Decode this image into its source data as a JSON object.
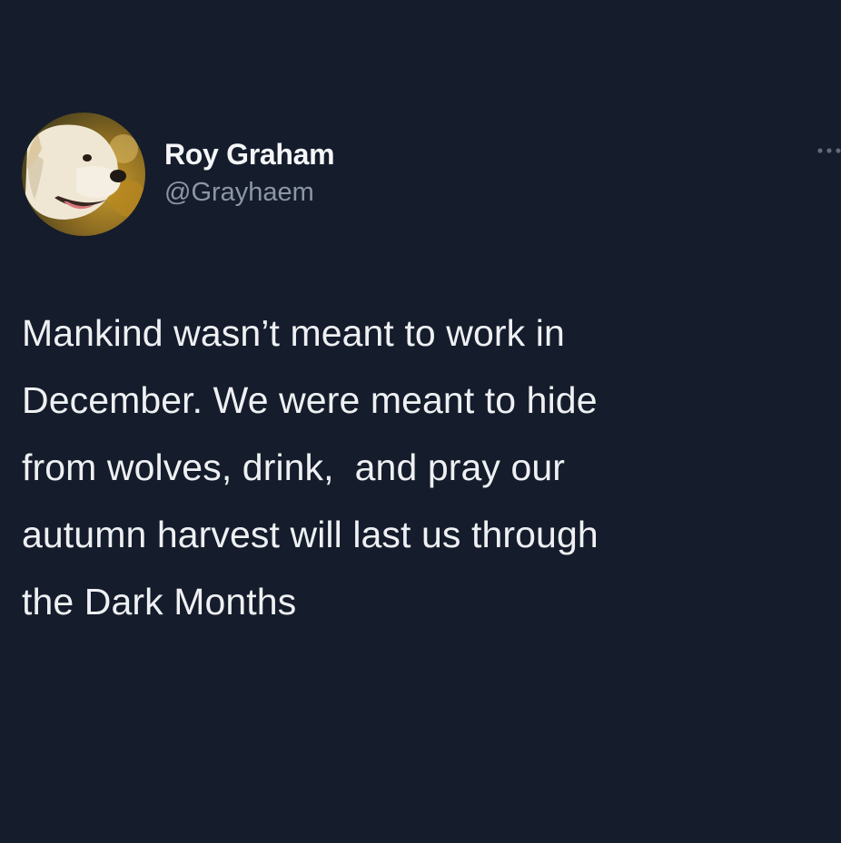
{
  "author": {
    "display_name": "Roy Graham",
    "handle": "@Grayhaem",
    "avatar_icon": "golden-retriever-avatar"
  },
  "menu": {
    "icon": "more-dots-icon"
  },
  "tweet": {
    "text": "Mankind wasn’t meant to work in\nDecember. We were meant to hide\nfrom wolves, drink,  and pray our\nautumn harvest will last us through\nthe Dark Months"
  },
  "colors": {
    "background": "#151c2b",
    "text": "#eef0f3",
    "handle": "#8b96a6"
  }
}
